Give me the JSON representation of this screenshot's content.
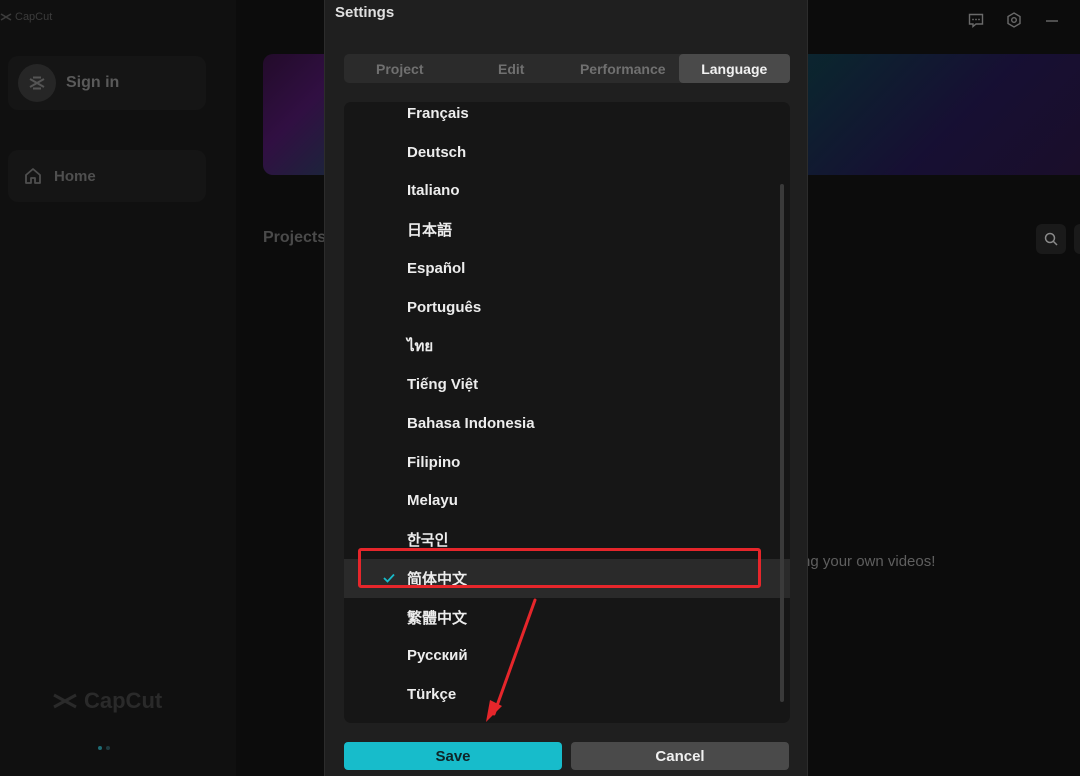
{
  "app": {
    "brand": "CapCut",
    "sidebar": {
      "signin_label": "Sign in",
      "home_label": "Home"
    },
    "main": {
      "projects_label": "Projects",
      "empty_hint": "ng your own videos!"
    }
  },
  "dialog": {
    "title": "Settings",
    "tabs": [
      {
        "label": "Project"
      },
      {
        "label": "Edit"
      },
      {
        "label": "Performance"
      },
      {
        "label": "Language",
        "active": true
      }
    ],
    "languages": [
      "Français",
      "Deutsch",
      "Italiano",
      "日本語",
      "Español",
      "Português",
      "ไทย",
      "Tiếng Việt",
      "Bahasa Indonesia",
      "Filipino",
      "Melayu",
      "한국인",
      "简体中文",
      "繁體中文",
      "Русский",
      "Türkçe"
    ],
    "selected_language": "简体中文",
    "save_label": "Save",
    "cancel_label": "Cancel"
  },
  "colors": {
    "accent": "#17bccb",
    "annotation": "#e6262b",
    "dialog_bg": "#1f1f1f"
  }
}
